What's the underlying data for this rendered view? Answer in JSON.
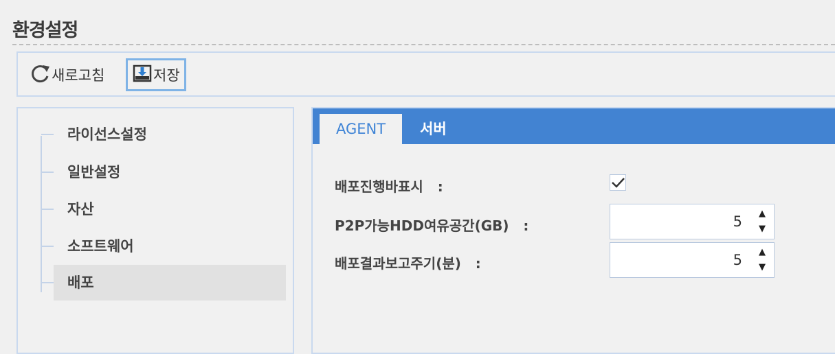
{
  "page": {
    "title": "환경설정"
  },
  "toolbar": {
    "refresh_label": "새로고침",
    "save_label": "저장"
  },
  "tree": {
    "items": [
      {
        "label": "라이선스설정"
      },
      {
        "label": "일반설정"
      },
      {
        "label": "자산"
      },
      {
        "label": "소프트웨어"
      },
      {
        "label": "배포",
        "selected": true
      }
    ]
  },
  "tabs": [
    {
      "label": "AGENT",
      "active": true
    },
    {
      "label": "서버",
      "active": false
    }
  ],
  "form": {
    "show_progress": {
      "label": "배포진행바표시",
      "separator": ":",
      "checked": true
    },
    "p2p_hdd_space": {
      "label": "P2P가능HDD여유공간(GB)",
      "separator": ":",
      "value": "5"
    },
    "report_interval": {
      "label": "배포결과보고주기(분)",
      "separator": ":",
      "value": "5"
    }
  },
  "colors": {
    "tab_bar": "#4283d2",
    "active_tab_text": "#3f84d6",
    "border": "#c9d9ef",
    "selected_bg": "#e1e1e1"
  }
}
